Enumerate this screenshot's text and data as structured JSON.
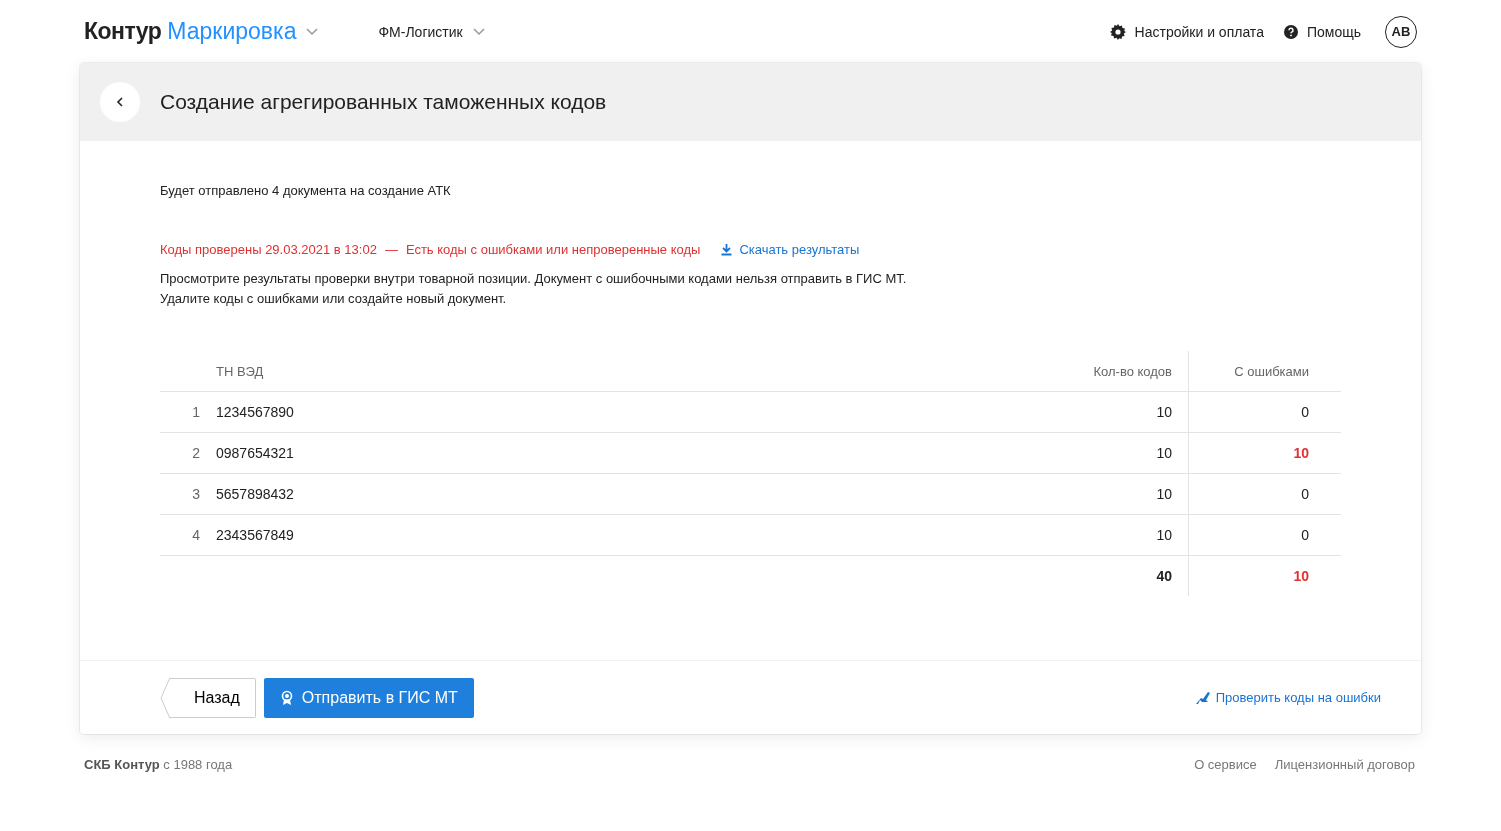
{
  "header": {
    "logo_brand": "Контур",
    "logo_product": "Маркировка",
    "organization": "ФМ-Логистик",
    "settings": "Настройки и оплата",
    "help": "Помощь",
    "avatar": "AB"
  },
  "page": {
    "title": "Создание агрегированных таможенных кодов",
    "summary": "Будет отправлено 4 документа на создание АТК",
    "check_status": "Коды проверены 29.03.2021 в 13:02",
    "check_separator": "—",
    "check_warning": "Есть коды с ошибками или непроверенные коды",
    "download_link": "Скачать результаты",
    "note_lines": [
      "Просмотрите результаты проверки внутри товарной позиции. Документ с ошибочными кодами нельзя отправить в ГИС МТ.",
      "Удалите коды с ошибками или создайте новый документ."
    ]
  },
  "table": {
    "columns": [
      "ТН ВЭД",
      "Кол-во кодов",
      "С ошибками"
    ],
    "rows": [
      {
        "index": "1",
        "code": "1234567890",
        "count": "10",
        "errors": "0",
        "has_errors": false
      },
      {
        "index": "2",
        "code": "0987654321",
        "count": "10",
        "errors": "10",
        "has_errors": true
      },
      {
        "index": "3",
        "code": "5657898432",
        "count": "10",
        "errors": "0",
        "has_errors": false
      },
      {
        "index": "4",
        "code": "2343567849",
        "count": "10",
        "errors": "0",
        "has_errors": false
      }
    ],
    "total": {
      "count": "40",
      "errors": "10",
      "has_errors": true
    }
  },
  "actions": {
    "back": "Назад",
    "send": "Отправить в ГИС МТ",
    "check": "Проверить коды на ошибки"
  },
  "footer": {
    "copyright": "**СКБ Контур** с 1988 года",
    "links": [
      "О сервисе",
      "Лицензионный договор"
    ]
  }
}
